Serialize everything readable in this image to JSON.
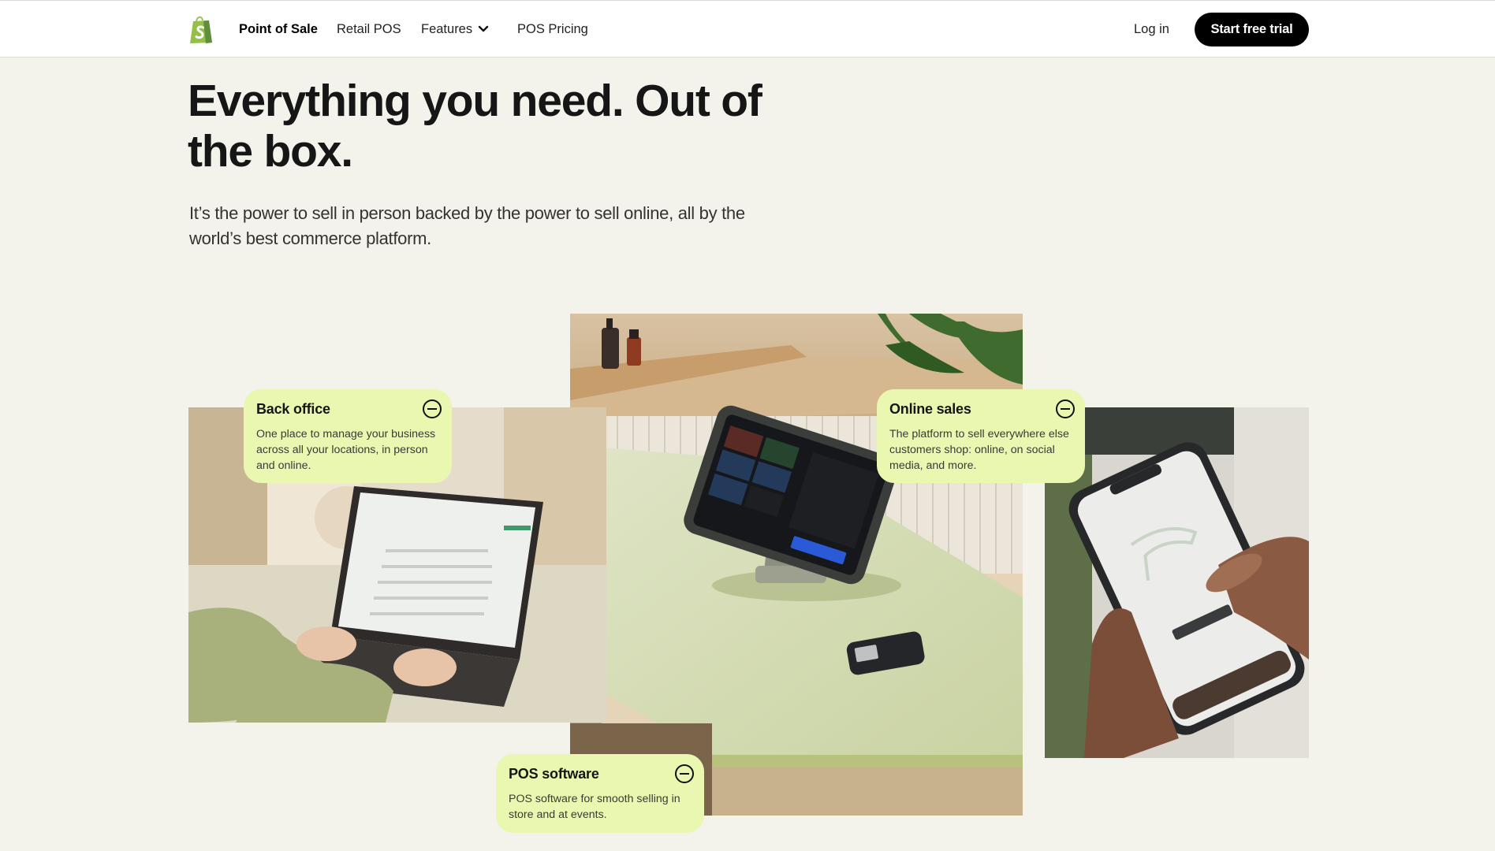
{
  "nav": {
    "brand_label": "Point of Sale",
    "links": [
      {
        "label": "Retail POS"
      },
      {
        "label": "Features",
        "has_dropdown": true
      },
      {
        "label": "POS Pricing"
      }
    ],
    "login_label": "Log in",
    "cta_label": "Start free trial",
    "logo_icon": "shopify-bag-icon"
  },
  "hero": {
    "headline": "Everything you need. Out of the box.",
    "subtext": "It’s the power to sell in person backed by the power to sell online, all by the world’s best commerce platform."
  },
  "features": [
    {
      "title": "Back office",
      "description": "One place to manage your business across all your locations, in person and online.",
      "icon": "collapse-minus-circle-icon",
      "image": "person typing on laptop"
    },
    {
      "title": "Online sales",
      "description": "The platform to sell everywhere else customers shop: online, on social media, and more.",
      "icon": "collapse-minus-circle-icon",
      "image": "hand holding phone showing shoe product page"
    },
    {
      "title": "POS software",
      "description": "POS software for smooth selling in store and at events.",
      "icon": "collapse-minus-circle-icon",
      "image": "POS tablet on stand with card reader on counter"
    }
  ],
  "colors": {
    "page_bg": "#f3f2eb",
    "card_bg": "#eaf7b1",
    "cta_bg": "#000000",
    "brand_green": "#95bf47"
  }
}
